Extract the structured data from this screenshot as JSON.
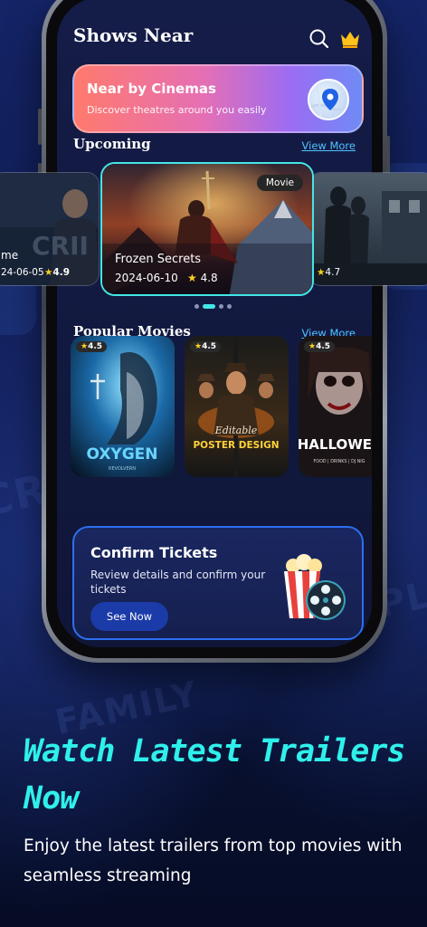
{
  "header": {
    "title": "Shows Near",
    "search_icon": "search-icon",
    "premium_icon": "crown-icon"
  },
  "banner": {
    "title": "Near by Cinemas",
    "subtitle": "Discover theatres around you easily",
    "icon": "map-pin-icon"
  },
  "upcoming": {
    "title": "Upcoming",
    "view_more": "View More",
    "left_card": {
      "name": "me",
      "date": "24-06-05",
      "rating": "4.9",
      "poster_text": "CRII"
    },
    "center_card": {
      "tag": "Movie",
      "name": "Frozen Secrets",
      "date": "2024-06-10",
      "rating": "4.8"
    },
    "right_card": {
      "rating": "4.7"
    }
  },
  "popular": {
    "title": "Popular Movies",
    "view_more": "View More",
    "movies": [
      {
        "rating": "4.5",
        "poster_title": "OXYGEN",
        "poster_sub": "REVOLVERN"
      },
      {
        "rating": "4.5",
        "poster_title": "POSTER DESIGN",
        "poster_sub": "Editable"
      },
      {
        "rating": "4.5",
        "poster_title": "HALLOWEE",
        "poster_sub": "FOOD | DRINKS | DJ NIG"
      }
    ]
  },
  "tickets": {
    "title": "Confirm Tickets",
    "subtitle": "Review details and confirm your tickets",
    "button": "See Now",
    "icon": "popcorn-film-reel-icon"
  },
  "promo": {
    "title": "Watch Latest Trailers Now",
    "subtitle": "Enjoy the latest trailers from top movies with seamless streaming"
  },
  "colors": {
    "accent_cyan": "#43e6e6",
    "link": "#4fc3ff",
    "promo_title": "#2ff0ea",
    "star": "#ffd21f"
  }
}
